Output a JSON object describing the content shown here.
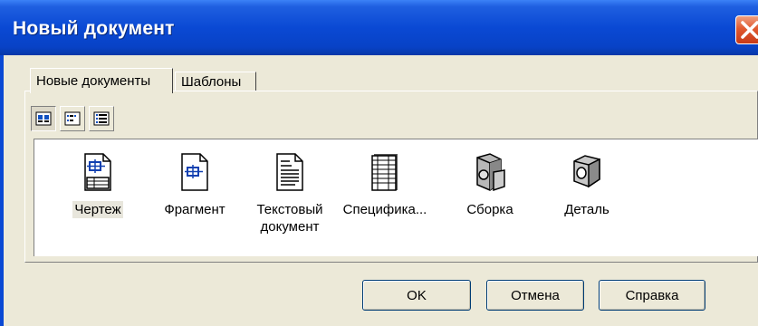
{
  "window": {
    "title": "Новый документ"
  },
  "tabs": [
    {
      "label": "Новые документы",
      "active": true
    },
    {
      "label": "Шаблоны",
      "active": false
    }
  ],
  "view_buttons": [
    {
      "icon": "large-icons-view-icon",
      "pressed": true
    },
    {
      "icon": "small-icons-view-icon",
      "pressed": false
    },
    {
      "icon": "list-view-icon",
      "pressed": false
    }
  ],
  "documents": [
    {
      "label": "Чертеж",
      "icon": "drawing-icon",
      "selected": true
    },
    {
      "label": "Фрагмент",
      "icon": "fragment-icon",
      "selected": false
    },
    {
      "label": "Текстовый документ",
      "icon": "text-document-icon",
      "selected": false
    },
    {
      "label": "Специфика...",
      "icon": "specification-icon",
      "selected": false
    },
    {
      "label": "Сборка",
      "icon": "assembly-icon",
      "selected": false
    },
    {
      "label": "Деталь",
      "icon": "part-icon",
      "selected": false
    }
  ],
  "buttons": {
    "ok": "OK",
    "cancel": "Отмена",
    "help": "Справка"
  },
  "colors": {
    "titlebar": "#0a49d4",
    "face": "#ece9d8",
    "close": "#e05a30"
  }
}
